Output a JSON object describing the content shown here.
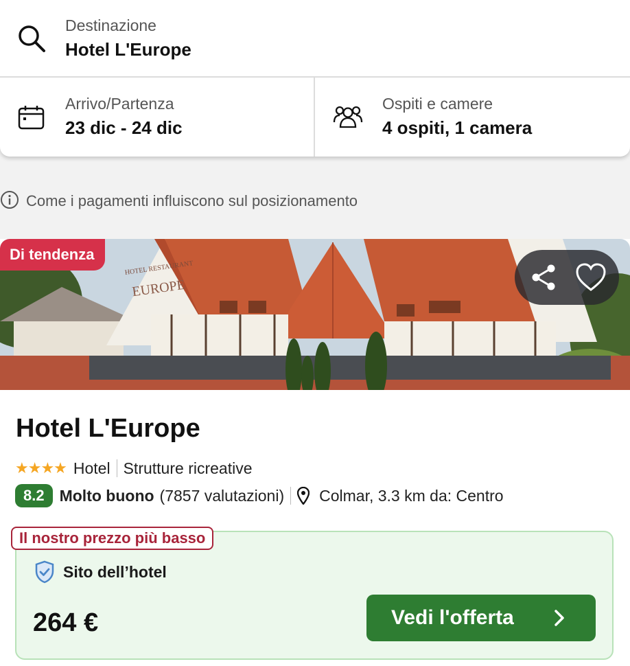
{
  "search": {
    "destination_label": "Destinazione",
    "destination_value": "Hotel L'Europe",
    "dates_label": "Arrivo/Partenza",
    "dates_value": "23 dic - 24 dic",
    "guests_label": "Ospiti e camere",
    "guests_value": "4 ospiti, 1 camera"
  },
  "info_text": "Come i pagamenti influiscono sul posizionamento",
  "hotel": {
    "trend_badge": "Di tendenza",
    "name": "Hotel L'Europe",
    "stars": "★★★★",
    "type": "Hotel",
    "amenities": "Strutture ricreative",
    "score": "8.2",
    "score_label": "Molto buono",
    "reviews": "(7857 valutazioni)",
    "location": "Colmar, 3.3 km da: Centro",
    "photo_sign_small": "HOTEL RESTAURANT",
    "photo_sign_big": "EUROPE"
  },
  "offer": {
    "lowest_badge": "Il nostro prezzo più basso",
    "provider": "Sito dell’hotel",
    "price": "264 €",
    "cta_label": "Vedi l'offerta"
  },
  "colors": {
    "accent_green": "#2e7d32",
    "trend_red": "#d6314a",
    "badge_red": "#a8243a",
    "star_orange": "#f5a623"
  }
}
